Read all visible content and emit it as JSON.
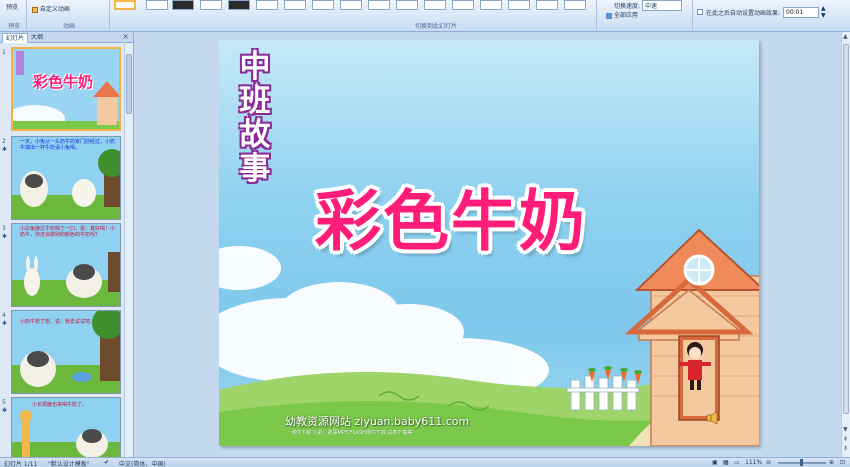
{
  "ribbon": {
    "preview_label": "预览",
    "custom_anim_label": "自定义动画",
    "group_preview": "预览",
    "group_animation": "动画",
    "group_transition": "切换到此幻灯片",
    "speed_label": "切换速度:",
    "speed_value": "中速",
    "apply_all": "全部应用",
    "auto_after": "在此之后自动设置动画效果:",
    "auto_time": "00:01"
  },
  "left_panel": {
    "tab_slides": "幻灯片",
    "tab_outline": "大纲",
    "close": "×",
    "slides": [
      {
        "num": "1",
        "title": "彩色牛奶",
        "tag": "中班故事"
      },
      {
        "num": "2",
        "text": "一天，小兔从一头奶牛的家门前经过，小奶牛端出一杯牛奶请小兔喝。"
      },
      {
        "num": "3",
        "text": "小白兔接过牛奶喝了一口，说：真好喝！小奶牛，你还会做别的颜色的牛奶吗？"
      },
      {
        "num": "4",
        "text": "小奶牛想了想，说：我去试试吧。"
      },
      {
        "num": "5",
        "text": "小长颈鹿也来喝牛奶了。"
      }
    ]
  },
  "slide": {
    "vertical_title": [
      "中",
      "班",
      "故",
      "事"
    ],
    "main_title": "彩色牛奶",
    "footer_site": "幼教资源网站 ziyuan.baby611.com",
    "footer_links": "课件下载    儿歌、故事MP3    FLASH课件下载    试卷下载等"
  },
  "status": {
    "slide_pos": "幻灯片 1/11",
    "template": "\"默认设计模板\"",
    "language": "中文(简体，中国)",
    "zoom": "111%"
  },
  "colors": {
    "title_pink": "#ff1d79",
    "vertical_title_outline": "#8a2b97",
    "sky": "#8fd1f0",
    "grass": "#7cc84a",
    "house_wall": "#f4c9a0",
    "roof": "#e8764a"
  }
}
